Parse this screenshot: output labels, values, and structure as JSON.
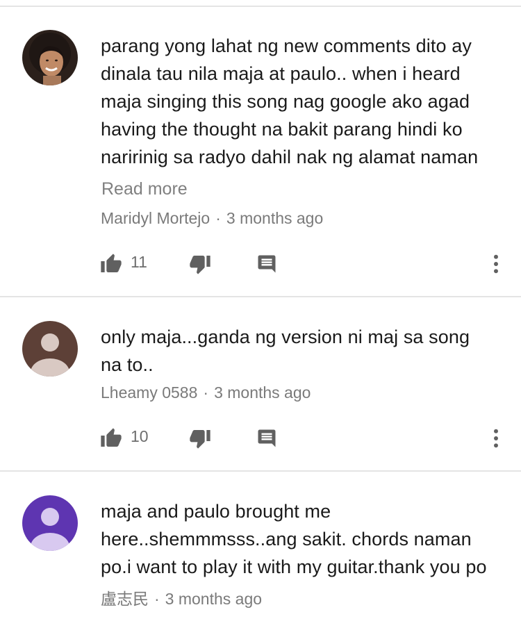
{
  "comments": [
    {
      "text": "parang yong lahat ng new comments dito ay\ndinala tau nila maja at paulo.. when i heard\nmaja singing this song nag google ako agad\nhaving the thought na bakit parang hindi ko\nnaririnig sa radyo dahil nak ng alamat naman",
      "read_more": "Read more",
      "author": "Maridyl Mortejo",
      "separator": "·",
      "time": "3 months ago",
      "likes": "11",
      "avatar_color": "#3a2a22"
    },
    {
      "text": "only maja...ganda ng version ni maj sa song\nna to..",
      "author": "Lheamy 0588",
      "separator": "·",
      "time": "3 months ago",
      "likes": "10",
      "avatar_color": "#5d4037"
    },
    {
      "text": "maja and paulo brought me\nhere..shemmmsss..ang sakit. chords naman\npo.i want to play it with my guitar.thank you po",
      "author": "盧志民",
      "separator": "·",
      "time": "3 months ago",
      "avatar_color": "#5e35b1"
    }
  ],
  "icons": {
    "like": "thumbs-up-icon",
    "dislike": "thumbs-down-icon",
    "reply": "reply-comment-icon",
    "more": "more-vertical-icon"
  },
  "colors": {
    "icon": "#606060",
    "divider": "#e4e4e4",
    "text": "#1a1a1a",
    "meta": "#7a7a7a"
  }
}
